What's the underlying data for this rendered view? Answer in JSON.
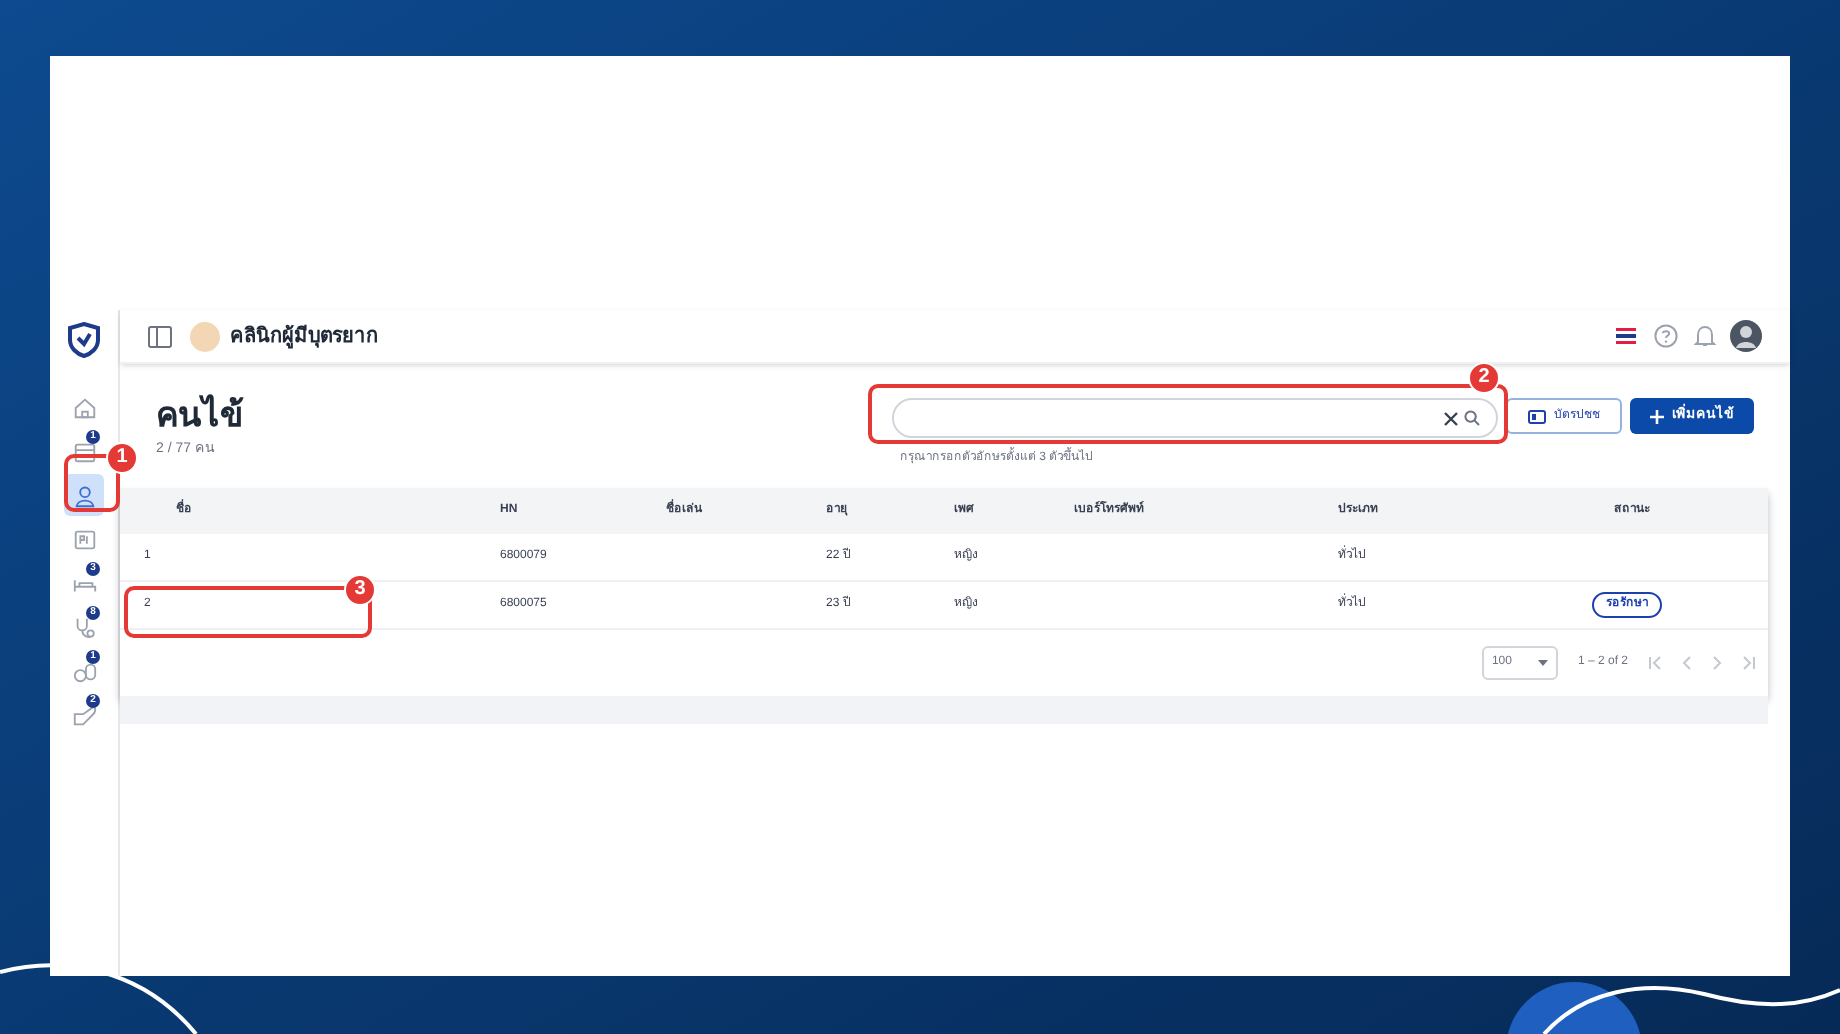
{
  "header": {
    "clinic_name": "คลินิกผู้มีบุตรยาก"
  },
  "sidebar": {
    "items": [
      {
        "kind": "home",
        "selected": false
      },
      {
        "kind": "calendar",
        "selected": false,
        "badge": "1"
      },
      {
        "kind": "person",
        "selected": true
      },
      {
        "kind": "card",
        "selected": false
      },
      {
        "kind": "bed",
        "selected": false,
        "badge": "3"
      },
      {
        "kind": "stethoscope",
        "selected": false,
        "badge": "8"
      },
      {
        "kind": "pills",
        "selected": false,
        "badge": "1"
      },
      {
        "kind": "hand",
        "selected": false,
        "badge": "2"
      }
    ]
  },
  "page": {
    "title": "คนไข้",
    "count": "2 / 77 คน"
  },
  "search": {
    "hint": "กรุณากรอกตัวอักษรตั้งแต่ 3 ตัวขึ้นไป"
  },
  "buttons": {
    "id_card": "บัตรปชช",
    "add": "เพิ่มคนไข้"
  },
  "table": {
    "columns": [
      "ชื่อ",
      "HN",
      "ชื่อเล่น",
      "อายุ",
      "เพศ",
      "เบอร์โทรศัพท์",
      "ประเภท",
      "สถานะ"
    ],
    "rows": [
      {
        "no": "1",
        "hn": "6800079",
        "age": "22 ปี",
        "sex": "หญิง",
        "type": "ทั่วไป"
      },
      {
        "no": "2",
        "hn": "6800075",
        "age": "23 ปี",
        "sex": "หญิง",
        "type": "ทั่วไป",
        "status": "รอรักษา"
      }
    ]
  },
  "pagination": {
    "page_size": "100",
    "range": "1 – 2 of 2"
  },
  "annotations": [
    {
      "number": "1"
    },
    {
      "number": "2"
    },
    {
      "number": "3"
    }
  ]
}
